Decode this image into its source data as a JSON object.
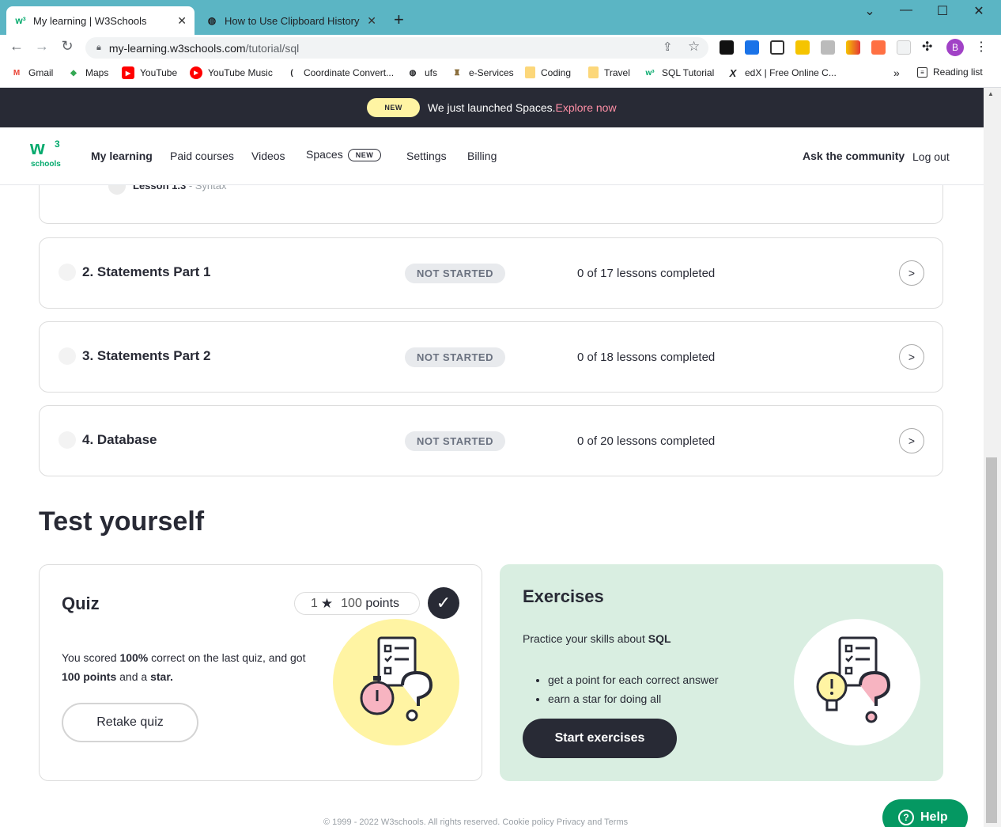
{
  "browser": {
    "tabs": [
      {
        "title": "My learning | W3Schools",
        "active": true
      },
      {
        "title": "How to Use Clipboard History on",
        "active": false
      }
    ],
    "url_host": "my-learning.w3schools.com",
    "url_path": "/tutorial/sql",
    "profile_initial": "B",
    "bookmarks": [
      "Gmail",
      "Maps",
      "YouTube",
      "YouTube Music",
      "Coordinate Convert...",
      "ufs",
      "e-Services",
      "Coding",
      "Travel",
      "SQL Tutorial",
      "edX | Free Online C..."
    ],
    "more_bookmarks": "»",
    "reading_list": "Reading list"
  },
  "banner": {
    "pill": "NEW",
    "text": "We just launched Spaces.",
    "link": "Explore now"
  },
  "logo": {
    "mark": "w",
    "sup": "3",
    "word": "schools"
  },
  "nav": {
    "items": [
      "My learning",
      "Paid courses",
      "Videos",
      "Spaces",
      "Settings",
      "Billing"
    ],
    "spaces_badge": "NEW",
    "ask": "Ask the community",
    "logout": "Log out"
  },
  "partial_lesson": {
    "label": "Lesson 1.3",
    "suffix": " - Syntax"
  },
  "modules": [
    {
      "title": "2. Statements Part 1",
      "status": "NOT STARTED",
      "progress": "0 of 17 lessons completed"
    },
    {
      "title": "3. Statements Part 2",
      "status": "NOT STARTED",
      "progress": "0 of 18 lessons completed"
    },
    {
      "title": "4. Database",
      "status": "NOT STARTED",
      "progress": "0 of 20 lessons completed"
    }
  ],
  "test": {
    "heading": "Test yourself",
    "quiz": {
      "title": "Quiz",
      "stars": "1",
      "points_num": "100",
      "points_word": "points",
      "line1_pre": "You scored ",
      "line1_bold": "100%",
      "line1_post": " correct on the last quiz, and got",
      "line2_bold": "100 points",
      "line2_mid": " and a ",
      "line2_bold2": "star.",
      "button": "Retake quiz"
    },
    "exercises": {
      "title": "Exercises",
      "desc_pre": "Practice your skills about ",
      "desc_bold": "SQL",
      "bullets": [
        "get a point for each correct answer",
        "earn a star for doing all"
      ],
      "button": "Start exercises"
    }
  },
  "footer": "© 1999 - 2022 W3schools. All rights reserved. Cookie policy  Privacy and Terms",
  "help": "Help",
  "colors": {
    "brand_green": "#04aa6d",
    "dark": "#282a35",
    "banner_pill": "#fff4a3",
    "exercise_bg": "#d9eee1",
    "quiz_circle": "#fff4a3"
  }
}
